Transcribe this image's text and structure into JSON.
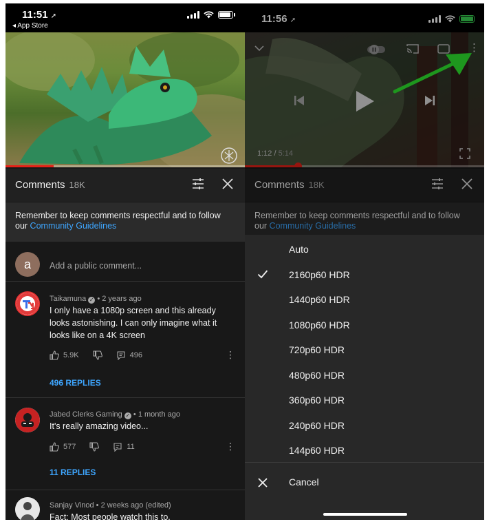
{
  "left": {
    "status": {
      "time": "11:51",
      "back_label": "◂ App Store"
    },
    "video": {
      "progress": 0.2
    },
    "comments_header": {
      "title": "Comments",
      "count": "18K"
    },
    "guidelines": {
      "text": "Remember to keep comments respectful and to follow our ",
      "link": "Community Guidelines"
    },
    "add_comment": {
      "avatar_letter": "a",
      "placeholder": "Add a public comment..."
    },
    "comments": [
      {
        "author": "Taikamuna",
        "age": "2 years ago",
        "text": "I only have a 1080p screen and this already looks astonishing. I can only imagine what it looks like on a 4K screen",
        "likes": "5.9K",
        "replies_count": "496",
        "replies_label": "496 REPLIES"
      },
      {
        "author": "Jabed Clerks Gaming",
        "age": "1 month ago",
        "text": "It's really amazing video...",
        "likes": "577",
        "replies_count": "11",
        "replies_label": "11 REPLIES"
      },
      {
        "author": "Sanjay Vinod",
        "age": "2 weeks ago (edited)",
        "text": "Fact: Most people watch this to,"
      }
    ]
  },
  "right": {
    "status": {
      "time": "11:56"
    },
    "player": {
      "time_current": "1:12",
      "time_total": "5:14",
      "progress": 0.22
    },
    "comments_header": {
      "title": "Comments",
      "count": "18K"
    },
    "guidelines": {
      "text": "Remember to keep comments respectful and to follow our ",
      "link": "Community Guidelines"
    },
    "quality": {
      "options": [
        "Auto",
        "2160p60 HDR",
        "1440p60 HDR",
        "1080p60 HDR",
        "720p60 HDR",
        "480p60 HDR",
        "360p60 HDR",
        "240p60 HDR",
        "144p60 HDR"
      ],
      "selected": "2160p60 HDR",
      "cancel_label": "Cancel"
    }
  },
  "colors": {
    "background": "#181818",
    "link": "#3ea6ff",
    "progress": "#e62117",
    "arrow": "#2ee82e"
  }
}
